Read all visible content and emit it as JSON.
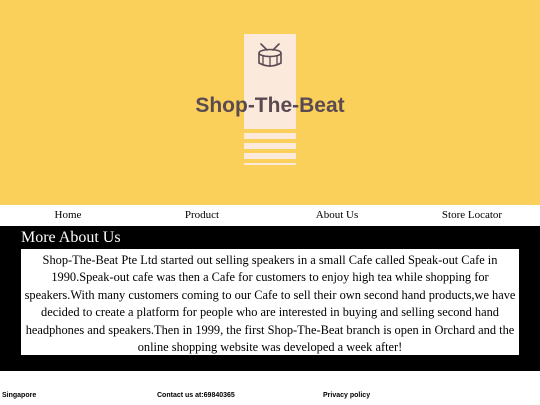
{
  "brand": {
    "name": "Shop-The-Beat",
    "logo_icon": "drum-icon",
    "colors": {
      "background": "#fbd05a",
      "card": "#fbe9dc",
      "text": "#5a4a52"
    }
  },
  "nav": {
    "items": [
      {
        "label": "Home"
      },
      {
        "label": "Product"
      },
      {
        "label": "About Us"
      },
      {
        "label": "Store Locator"
      }
    ]
  },
  "about": {
    "title": "More About Us",
    "body": "Shop-The-Beat Pte Ltd started out selling speakers in a small Cafe called Speak-out Cafe in 1990.Speak-out cafe was then a Cafe for customers to enjoy high tea while shopping for speakers.With many customers coming to our Cafe to sell their own second hand products,we have decided to create a platform for people who are interested in buying and selling second hand headphones and speakers.Then in 1999, the first Shop-The-Beat branch is open in Orchard and the online shopping website was developed a week after!"
  },
  "footer": {
    "location": "Singapore",
    "contact": "Contact us at:69840365",
    "privacy": "Privacy policy"
  }
}
